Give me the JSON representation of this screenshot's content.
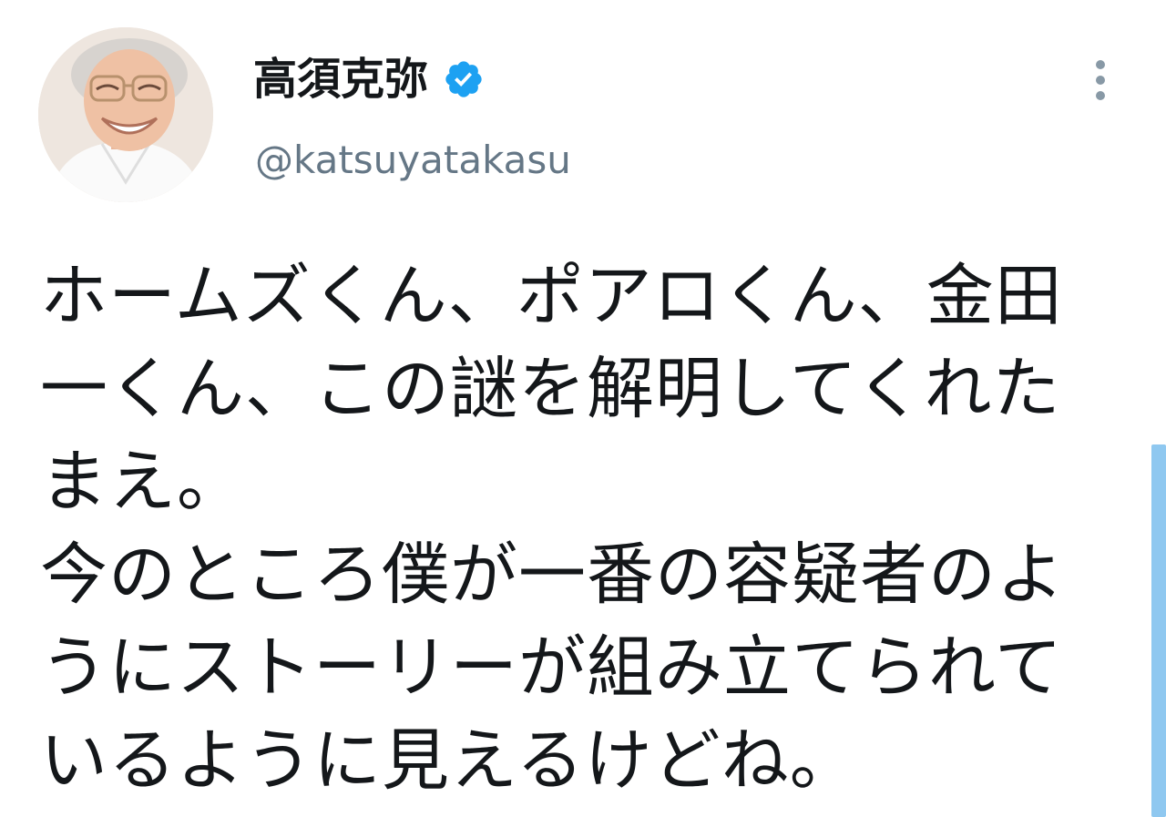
{
  "user": {
    "display_name": "高須克弥",
    "handle": "@katsuyatakasu",
    "verified": true,
    "avatar_icon": "user-avatar"
  },
  "header": {
    "more_icon": "more-vertical-icon",
    "verified_icon": "verified-badge-icon"
  },
  "tweet": {
    "text": "ホームズくん、ポアロくん、金田一くん、この謎を解明してくれたまえ。\n今のところ僕が一番の容疑者のようにストーリーが組み立てられているように見えるけどね。"
  },
  "colors": {
    "verified_blue": "#1da1f2",
    "handle_gray": "#657786",
    "more_gray": "#8899a6",
    "scrollbar": "#8fc8f0"
  }
}
